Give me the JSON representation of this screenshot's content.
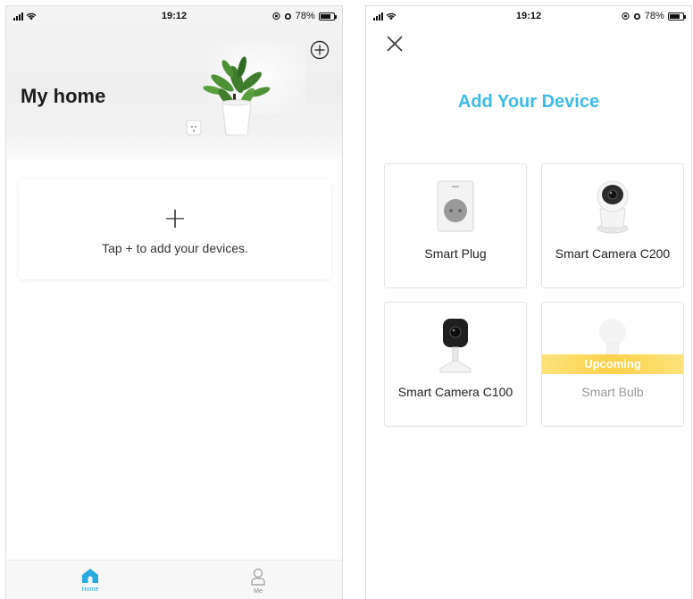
{
  "status_left": {
    "time": "19:12",
    "battery": "78%"
  },
  "status_right": {
    "time": "19:12",
    "battery": "78%"
  },
  "home": {
    "title": "My home",
    "empty_plus": "+",
    "empty_message": "Tap + to add your devices.",
    "tabs": [
      {
        "label": "Home",
        "icon": "home-icon",
        "active": true
      },
      {
        "label": "Me",
        "icon": "person-icon",
        "active": false
      }
    ]
  },
  "add_device": {
    "title": "Add Your Device",
    "devices": [
      {
        "name": "Smart Plug",
        "icon": "smart-plug-icon"
      },
      {
        "name": "Smart Camera C200",
        "icon": "camera-c200-icon"
      },
      {
        "name": "Smart Camera C100",
        "icon": "camera-c100-icon"
      },
      {
        "name": "Smart Bulb",
        "icon": "smart-bulb-icon",
        "badge": "Upcoming"
      }
    ]
  },
  "colors": {
    "accent": "#3dbbe8",
    "tab_active": "#2aa8e0",
    "upcoming": "#fad14a"
  }
}
